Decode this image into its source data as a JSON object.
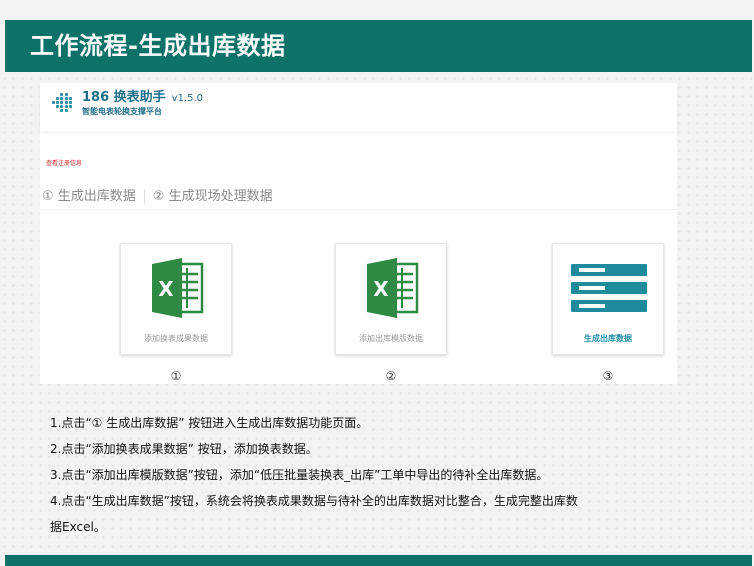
{
  "slide": {
    "title": "工作流程-生成出库数据",
    "accent_color": "#0e7268"
  },
  "app": {
    "name": "186 换表助手",
    "version": "v1.5.0",
    "subtitle": "智能电表轮换支撑平台",
    "register_link": "查看注册信息",
    "tabs": [
      {
        "label": "① 生成出库数据"
      },
      {
        "label": "② 生成现场处理数据"
      }
    ],
    "cards": [
      {
        "label": "添加换表成果数据",
        "icon": "excel-icon",
        "number": "①"
      },
      {
        "label": "添加出库模版数据",
        "icon": "excel-icon",
        "number": "②"
      },
      {
        "label": "生成出库数据",
        "icon": "list-bars-icon",
        "number": "③"
      }
    ]
  },
  "steps": [
    "1.点击“① 生成出库数据” 按钮进入生成出库数据功能页面。",
    "2.点击“添加换表成果数据” 按钮，添加换表数据。",
    "3.点击“添加出库模版数据”按钮，添加“低压批量装换表_出库”工单中导出的待补全出库数据。",
    "4.点击“生成出库数据”按钮，系统会将换表成果数据与待补全的出库数据对比整合，生成完整出库数",
    "据Excel。"
  ]
}
